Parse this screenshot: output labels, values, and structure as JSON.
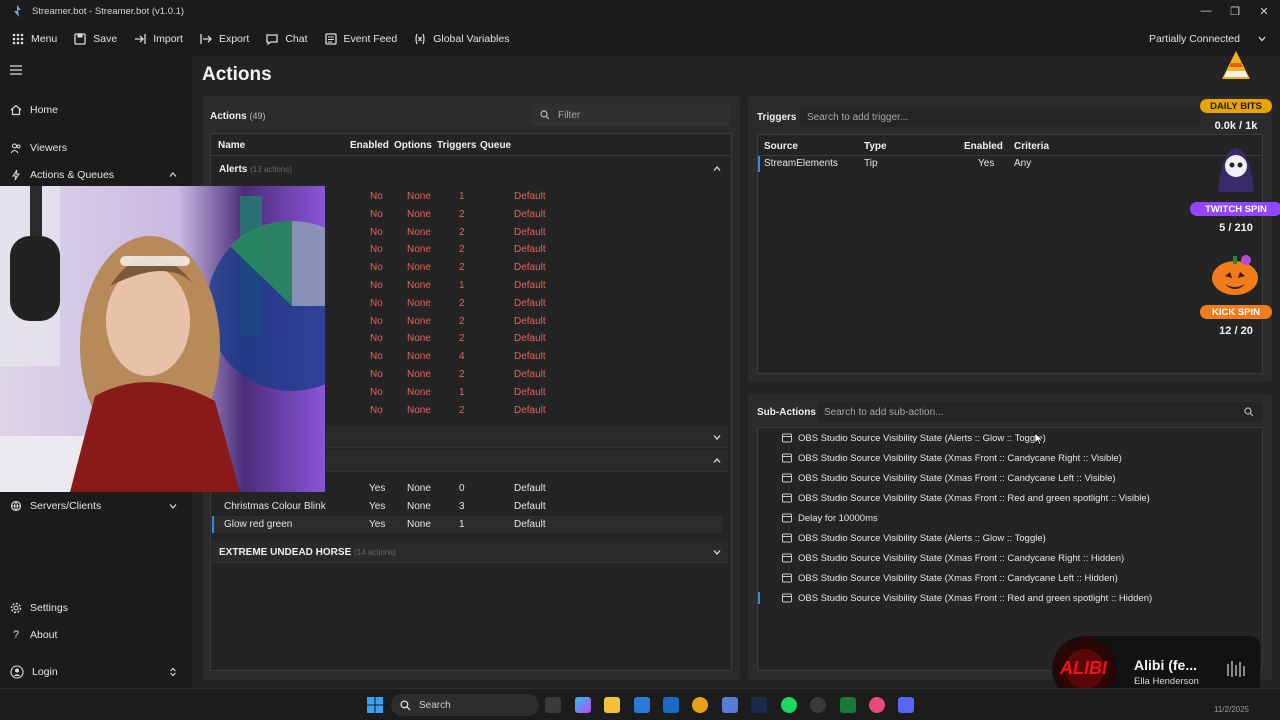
{
  "window": {
    "title": "Streamer.bot - Streamer.bot (v1.0.1)"
  },
  "menubar": {
    "items": [
      {
        "label": "Menu",
        "icon": "grid-icon"
      },
      {
        "label": "Save",
        "icon": "save-icon"
      },
      {
        "label": "Import",
        "icon": "import-icon"
      },
      {
        "label": "Export",
        "icon": "export-icon"
      },
      {
        "label": "Chat",
        "icon": "chat-icon"
      },
      {
        "label": "Event Feed",
        "icon": "feed-icon"
      },
      {
        "label": "Global Variables",
        "icon": "variable-icon"
      }
    ],
    "connection": "Partially Connected"
  },
  "sidebar": {
    "items": [
      {
        "label": "Home",
        "icon": "home-icon"
      },
      {
        "label": "Viewers",
        "icon": "viewers-icon"
      },
      {
        "label": "Actions & Queues",
        "icon": "bolt-icon"
      },
      {
        "label": "Servers/Clients",
        "icon": "server-icon"
      },
      {
        "label": "Settings",
        "icon": "gear-icon"
      },
      {
        "label": "About",
        "icon": "question-icon"
      },
      {
        "label": "Login",
        "icon": "user-icon"
      }
    ]
  },
  "page": {
    "title": "Actions"
  },
  "actions": {
    "title": "Actions",
    "count": "(49)",
    "filter_placeholder": "Filter",
    "columns": [
      "Name",
      "Enabled",
      "Options",
      "Triggers",
      "Queue"
    ],
    "alerts_group": {
      "name": "Alerts",
      "count": "(13 actions)"
    },
    "alerts_rows": [
      {
        "enabled": "No",
        "options": "None",
        "triggers": "1",
        "queue": "Default"
      },
      {
        "enabled": "No",
        "options": "None",
        "triggers": "2",
        "queue": "Default"
      },
      {
        "enabled": "No",
        "options": "None",
        "triggers": "2",
        "queue": "Default"
      },
      {
        "enabled": "No",
        "options": "None",
        "triggers": "2",
        "queue": "Default"
      },
      {
        "enabled": "No",
        "options": "None",
        "triggers": "2",
        "queue": "Default"
      },
      {
        "enabled": "No",
        "options": "None",
        "triggers": "1",
        "queue": "Default"
      },
      {
        "enabled": "No",
        "options": "None",
        "triggers": "2",
        "queue": "Default"
      },
      {
        "enabled": "No",
        "options": "None",
        "triggers": "2",
        "queue": "Default"
      },
      {
        "enabled": "No",
        "options": "None",
        "triggers": "2",
        "queue": "Default"
      },
      {
        "enabled": "No",
        "options": "None",
        "triggers": "4",
        "queue": "Default"
      },
      {
        "enabled": "No",
        "options": "None",
        "triggers": "2",
        "queue": "Default"
      },
      {
        "enabled": "No",
        "options": "None",
        "triggers": "1",
        "queue": "Default"
      },
      {
        "enabled": "No",
        "options": "None",
        "triggers": "2",
        "queue": "Default"
      }
    ],
    "third_group_rows": [
      {
        "name": "",
        "enabled": "Yes",
        "options": "None",
        "triggers": "0",
        "queue": "Default"
      },
      {
        "name": "Christmas Colour Blink",
        "enabled": "Yes",
        "options": "None",
        "triggers": "3",
        "queue": "Default"
      },
      {
        "name": "Glow red green",
        "enabled": "Yes",
        "options": "None",
        "triggers": "1",
        "queue": "Default"
      }
    ],
    "last_group": {
      "name": "EXTREME UNDEAD HORSE",
      "count": "(14 actions)"
    }
  },
  "triggers": {
    "title": "Triggers",
    "search_placeholder": "Search to add trigger...",
    "columns": [
      "Source",
      "Type",
      "Enabled",
      "Criteria"
    ],
    "rows": [
      {
        "source": "StreamElements",
        "type": "Tip",
        "enabled": "Yes",
        "criteria": "Any"
      }
    ]
  },
  "subactions": {
    "title": "Sub-Actions",
    "search_placeholder": "Search to add sub-action...",
    "items": [
      "OBS Studio Source Visibility State (Alerts :: Glow :: Toggle)",
      "OBS Studio Source Visibility State (Xmas Front :: Candycane Right :: Visible)",
      "OBS Studio Source Visibility State (Xmas Front ::  Candycane Left :: Visible)",
      "OBS Studio Source Visibility State (Xmas Front :: Red and green spotlight :: Visible)",
      "Delay for 10000ms",
      "OBS Studio Source Visibility State (Alerts :: Glow :: Toggle)",
      "OBS Studio Source Visibility State (Xmas Front :: Candycane Right :: Hidden)",
      "OBS Studio Source Visibility State (Xmas Front ::  Candycane Left :: Hidden)",
      "OBS Studio Source Visibility State (Xmas Front :: Red and green spotlight :: Hidden)"
    ]
  },
  "overlay": {
    "daily_bits": {
      "label": "DAILY BITS",
      "value": "0.0k / 1k",
      "progress": 0.0
    },
    "twitch_spin": {
      "label": "TWITCH SPIN",
      "value": "5 / 210",
      "progress": 0.024
    },
    "kick_spin": {
      "label": "KICK SPIN",
      "value": "12 / 20",
      "progress": 0.6
    },
    "colors": {
      "daily": "#e8a400",
      "twitch": "#9146ff",
      "kick": "#f07c1c"
    }
  },
  "music": {
    "title": "Alibi (fe...",
    "artist": "Ella Henderson",
    "cover_text": "ALIBI"
  },
  "taskbar": {
    "search_placeholder": "Search",
    "date": "11/2/2025"
  },
  "colors": {
    "accent": "#2d8cf0",
    "disabled_text": "#e0645f",
    "panel": "#2b2b2b"
  }
}
